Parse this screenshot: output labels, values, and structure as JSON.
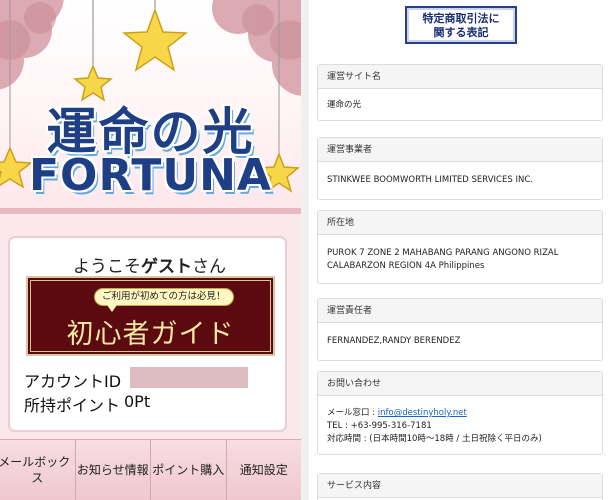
{
  "left_panel": {
    "logo": {
      "line1": "運命の光",
      "line2": "FORTUNA"
    },
    "welcome": {
      "prefix": "ようこそ",
      "name": "ゲスト",
      "suffix": "さん"
    },
    "guide": {
      "bubble": "ご利用が初めての方は必見！",
      "label": "初心者ガイド"
    },
    "account": {
      "id_label": "アカウントID",
      "points_label": "所持ポイント",
      "points_value": "0Pt"
    },
    "nav": [
      "メールボックス",
      "お知らせ情報",
      "ポイント購入",
      "通知設定"
    ]
  },
  "right_panel": {
    "heading": {
      "line1": "特定商取引法に",
      "line2": "関する表記"
    },
    "sections": [
      {
        "header": "運営サイト名",
        "lines": [
          "運命の光"
        ]
      },
      {
        "header": "運営事業者",
        "lines": [
          "STINKWEE BOOMWORTH LIMITED SERVICES INC."
        ]
      },
      {
        "header": "所在地",
        "lines": [
          "PUROK 7 ZONE 2 MAHABANG PARANG ANGONO RIZAL",
          "CALABARZON REGION 4A Philippines"
        ]
      },
      {
        "header": "運営責任者",
        "lines": [
          "FERNANDEZ,RANDY BERENDEZ"
        ]
      },
      {
        "header": "お問い合わせ",
        "mail_label": "メール窓口 : ",
        "mail_link": "info@destinyholy.net",
        "tel": "TEL : +63-995-316-7181",
        "hours": "対応時間 : (日本時間10時～18時 / 土日祝除く平日のみ)"
      },
      {
        "header": "サービス内容"
      }
    ]
  },
  "colors": {
    "logo_blue": "#1e3f86",
    "guide_bg": "#5b0b10",
    "guide_text": "#f4e7a3",
    "nav_bg": "#efc8cf",
    "link": "#1565c0"
  }
}
